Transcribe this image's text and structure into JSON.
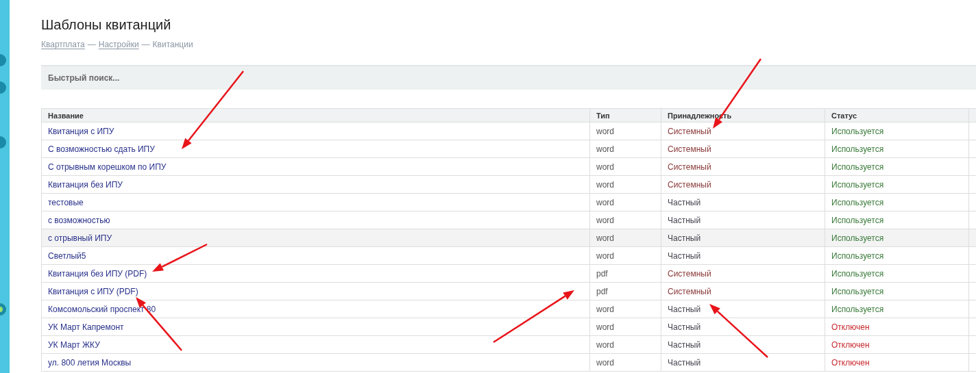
{
  "title": "Шаблоны квитанций",
  "breadcrumb": [
    {
      "text": "Квартплата",
      "link": true
    },
    {
      "text": "Настройки",
      "link": true
    },
    {
      "text": "Квитанции",
      "link": false
    }
  ],
  "breadcrumb_separator": "—",
  "search": {
    "placeholder": "Быстрый поиск..."
  },
  "table": {
    "columns": [
      "Название",
      "Тип",
      "Принадлежность",
      "Статус"
    ],
    "rows": [
      {
        "name": "Квитанция с ИПУ",
        "type": "word",
        "owner": {
          "text": "Системный",
          "color": "#8b3a3a"
        },
        "status": {
          "text": "Используется",
          "color": "#3a7a3a"
        },
        "selected": false
      },
      {
        "name": "С возможностью сдать ИПУ",
        "type": "word",
        "owner": {
          "text": "Системный",
          "color": "#8b3a3a"
        },
        "status": {
          "text": "Используется",
          "color": "#3a7a3a"
        },
        "selected": false
      },
      {
        "name": "С отрывным корешком по ИПУ",
        "type": "word",
        "owner": {
          "text": "Системный",
          "color": "#8b3a3a"
        },
        "status": {
          "text": "Используется",
          "color": "#3a7a3a"
        },
        "selected": false
      },
      {
        "name": "Квитанция без ИПУ",
        "type": "word",
        "owner": {
          "text": "Системный",
          "color": "#8b3a3a"
        },
        "status": {
          "text": "Используется",
          "color": "#3a7a3a"
        },
        "selected": false
      },
      {
        "name": "тестовые",
        "type": "word",
        "owner": {
          "text": "Частный",
          "color": "#44444e"
        },
        "status": {
          "text": "Используется",
          "color": "#3a7a3a"
        },
        "selected": false
      },
      {
        "name": "с возможностью",
        "type": "word",
        "owner": {
          "text": "Частный",
          "color": "#44444e"
        },
        "status": {
          "text": "Используется",
          "color": "#3a7a3a"
        },
        "selected": false
      },
      {
        "name": "с отрывный ИПУ",
        "type": "word",
        "owner": {
          "text": "Частный",
          "color": "#44444e"
        },
        "status": {
          "text": "Используется",
          "color": "#3a7a3a"
        },
        "selected": true
      },
      {
        "name": "Светлый5",
        "type": "word",
        "owner": {
          "text": "Частный",
          "color": "#44444e"
        },
        "status": {
          "text": "Используется",
          "color": "#3a7a3a"
        },
        "selected": false
      },
      {
        "name": "Квитанция без ИПУ (PDF)",
        "type": "pdf",
        "owner": {
          "text": "Системный",
          "color": "#8b3a3a"
        },
        "status": {
          "text": "Используется",
          "color": "#3a7a3a"
        },
        "selected": false
      },
      {
        "name": "Квитанция с ИПУ (PDF)",
        "type": "pdf",
        "owner": {
          "text": "Системный",
          "color": "#8b3a3a"
        },
        "status": {
          "text": "Используется",
          "color": "#3a7a3a"
        },
        "selected": false
      },
      {
        "name": "Комсомольский проспект 80",
        "type": "word",
        "owner": {
          "text": "Частный",
          "color": "#44444e"
        },
        "status": {
          "text": "Используется",
          "color": "#3a7a3a"
        },
        "selected": false
      },
      {
        "name": "УК Март Капремонт",
        "type": "word",
        "owner": {
          "text": "Частный",
          "color": "#44444e"
        },
        "status": {
          "text": "Отключен",
          "color": "#c8282e"
        },
        "selected": false
      },
      {
        "name": "УК Март ЖКУ",
        "type": "word",
        "owner": {
          "text": "Частный",
          "color": "#44444e"
        },
        "status": {
          "text": "Отключен",
          "color": "#c8282e"
        },
        "selected": false
      },
      {
        "name": "ул. 800 летия Москвы",
        "type": "word",
        "owner": {
          "text": "Частный",
          "color": "#44444e"
        },
        "status": {
          "text": "Отключен",
          "color": "#c8282e"
        },
        "selected": false
      }
    ]
  }
}
